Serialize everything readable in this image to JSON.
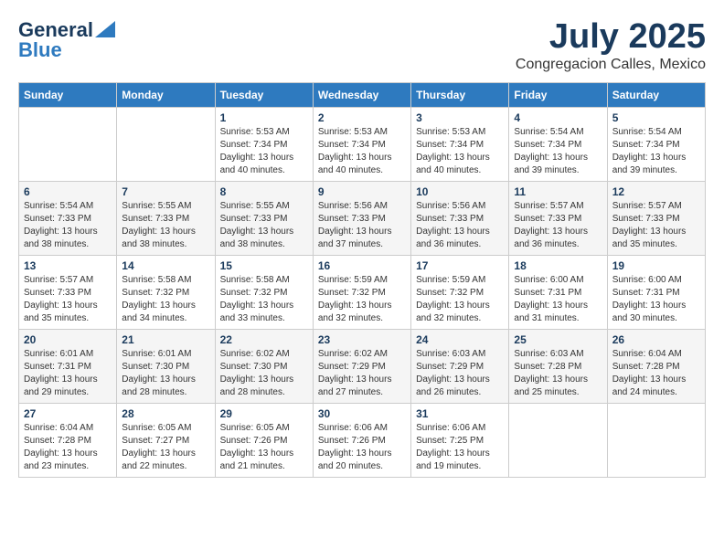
{
  "header": {
    "logo_general": "General",
    "logo_blue": "Blue",
    "title": "July 2025",
    "subtitle": "Congregacion Calles, Mexico"
  },
  "weekdays": [
    "Sunday",
    "Monday",
    "Tuesday",
    "Wednesday",
    "Thursday",
    "Friday",
    "Saturday"
  ],
  "weeks": [
    [
      {
        "day": "",
        "sunrise": "",
        "sunset": "",
        "daylight": ""
      },
      {
        "day": "",
        "sunrise": "",
        "sunset": "",
        "daylight": ""
      },
      {
        "day": "1",
        "sunrise": "Sunrise: 5:53 AM",
        "sunset": "Sunset: 7:34 PM",
        "daylight": "Daylight: 13 hours and 40 minutes."
      },
      {
        "day": "2",
        "sunrise": "Sunrise: 5:53 AM",
        "sunset": "Sunset: 7:34 PM",
        "daylight": "Daylight: 13 hours and 40 minutes."
      },
      {
        "day": "3",
        "sunrise": "Sunrise: 5:53 AM",
        "sunset": "Sunset: 7:34 PM",
        "daylight": "Daylight: 13 hours and 40 minutes."
      },
      {
        "day": "4",
        "sunrise": "Sunrise: 5:54 AM",
        "sunset": "Sunset: 7:34 PM",
        "daylight": "Daylight: 13 hours and 39 minutes."
      },
      {
        "day": "5",
        "sunrise": "Sunrise: 5:54 AM",
        "sunset": "Sunset: 7:34 PM",
        "daylight": "Daylight: 13 hours and 39 minutes."
      }
    ],
    [
      {
        "day": "6",
        "sunrise": "Sunrise: 5:54 AM",
        "sunset": "Sunset: 7:33 PM",
        "daylight": "Daylight: 13 hours and 38 minutes."
      },
      {
        "day": "7",
        "sunrise": "Sunrise: 5:55 AM",
        "sunset": "Sunset: 7:33 PM",
        "daylight": "Daylight: 13 hours and 38 minutes."
      },
      {
        "day": "8",
        "sunrise": "Sunrise: 5:55 AM",
        "sunset": "Sunset: 7:33 PM",
        "daylight": "Daylight: 13 hours and 38 minutes."
      },
      {
        "day": "9",
        "sunrise": "Sunrise: 5:56 AM",
        "sunset": "Sunset: 7:33 PM",
        "daylight": "Daylight: 13 hours and 37 minutes."
      },
      {
        "day": "10",
        "sunrise": "Sunrise: 5:56 AM",
        "sunset": "Sunset: 7:33 PM",
        "daylight": "Daylight: 13 hours and 36 minutes."
      },
      {
        "day": "11",
        "sunrise": "Sunrise: 5:57 AM",
        "sunset": "Sunset: 7:33 PM",
        "daylight": "Daylight: 13 hours and 36 minutes."
      },
      {
        "day": "12",
        "sunrise": "Sunrise: 5:57 AM",
        "sunset": "Sunset: 7:33 PM",
        "daylight": "Daylight: 13 hours and 35 minutes."
      }
    ],
    [
      {
        "day": "13",
        "sunrise": "Sunrise: 5:57 AM",
        "sunset": "Sunset: 7:33 PM",
        "daylight": "Daylight: 13 hours and 35 minutes."
      },
      {
        "day": "14",
        "sunrise": "Sunrise: 5:58 AM",
        "sunset": "Sunset: 7:32 PM",
        "daylight": "Daylight: 13 hours and 34 minutes."
      },
      {
        "day": "15",
        "sunrise": "Sunrise: 5:58 AM",
        "sunset": "Sunset: 7:32 PM",
        "daylight": "Daylight: 13 hours and 33 minutes."
      },
      {
        "day": "16",
        "sunrise": "Sunrise: 5:59 AM",
        "sunset": "Sunset: 7:32 PM",
        "daylight": "Daylight: 13 hours and 32 minutes."
      },
      {
        "day": "17",
        "sunrise": "Sunrise: 5:59 AM",
        "sunset": "Sunset: 7:32 PM",
        "daylight": "Daylight: 13 hours and 32 minutes."
      },
      {
        "day": "18",
        "sunrise": "Sunrise: 6:00 AM",
        "sunset": "Sunset: 7:31 PM",
        "daylight": "Daylight: 13 hours and 31 minutes."
      },
      {
        "day": "19",
        "sunrise": "Sunrise: 6:00 AM",
        "sunset": "Sunset: 7:31 PM",
        "daylight": "Daylight: 13 hours and 30 minutes."
      }
    ],
    [
      {
        "day": "20",
        "sunrise": "Sunrise: 6:01 AM",
        "sunset": "Sunset: 7:31 PM",
        "daylight": "Daylight: 13 hours and 29 minutes."
      },
      {
        "day": "21",
        "sunrise": "Sunrise: 6:01 AM",
        "sunset": "Sunset: 7:30 PM",
        "daylight": "Daylight: 13 hours and 28 minutes."
      },
      {
        "day": "22",
        "sunrise": "Sunrise: 6:02 AM",
        "sunset": "Sunset: 7:30 PM",
        "daylight": "Daylight: 13 hours and 28 minutes."
      },
      {
        "day": "23",
        "sunrise": "Sunrise: 6:02 AM",
        "sunset": "Sunset: 7:29 PM",
        "daylight": "Daylight: 13 hours and 27 minutes."
      },
      {
        "day": "24",
        "sunrise": "Sunrise: 6:03 AM",
        "sunset": "Sunset: 7:29 PM",
        "daylight": "Daylight: 13 hours and 26 minutes."
      },
      {
        "day": "25",
        "sunrise": "Sunrise: 6:03 AM",
        "sunset": "Sunset: 7:28 PM",
        "daylight": "Daylight: 13 hours and 25 minutes."
      },
      {
        "day": "26",
        "sunrise": "Sunrise: 6:04 AM",
        "sunset": "Sunset: 7:28 PM",
        "daylight": "Daylight: 13 hours and 24 minutes."
      }
    ],
    [
      {
        "day": "27",
        "sunrise": "Sunrise: 6:04 AM",
        "sunset": "Sunset: 7:28 PM",
        "daylight": "Daylight: 13 hours and 23 minutes."
      },
      {
        "day": "28",
        "sunrise": "Sunrise: 6:05 AM",
        "sunset": "Sunset: 7:27 PM",
        "daylight": "Daylight: 13 hours and 22 minutes."
      },
      {
        "day": "29",
        "sunrise": "Sunrise: 6:05 AM",
        "sunset": "Sunset: 7:26 PM",
        "daylight": "Daylight: 13 hours and 21 minutes."
      },
      {
        "day": "30",
        "sunrise": "Sunrise: 6:06 AM",
        "sunset": "Sunset: 7:26 PM",
        "daylight": "Daylight: 13 hours and 20 minutes."
      },
      {
        "day": "31",
        "sunrise": "Sunrise: 6:06 AM",
        "sunset": "Sunset: 7:25 PM",
        "daylight": "Daylight: 13 hours and 19 minutes."
      },
      {
        "day": "",
        "sunrise": "",
        "sunset": "",
        "daylight": ""
      },
      {
        "day": "",
        "sunrise": "",
        "sunset": "",
        "daylight": ""
      }
    ]
  ]
}
